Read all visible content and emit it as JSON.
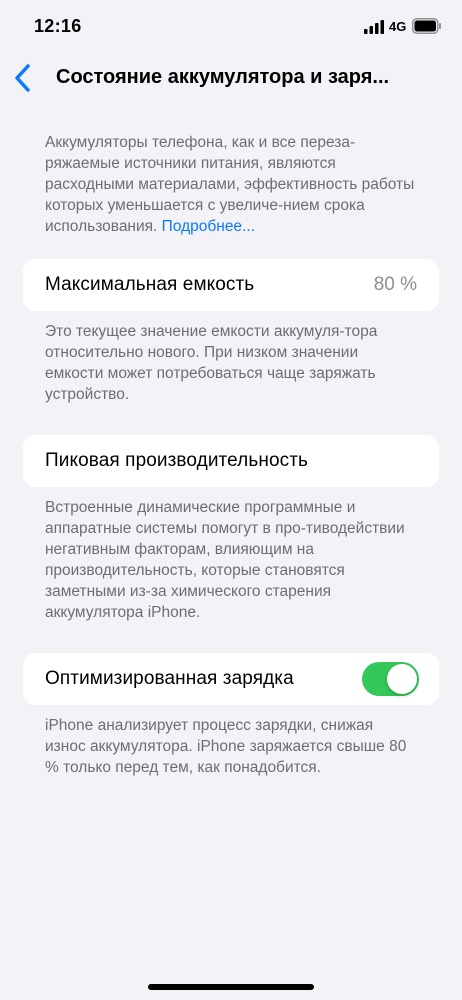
{
  "status_bar": {
    "time": "12:16",
    "network": "4G",
    "icons": [
      "signal-icon",
      "battery-icon"
    ]
  },
  "nav": {
    "title": "Состояние аккумулятора и заря...",
    "back_icon": "chevron-left-icon"
  },
  "intro": {
    "text": "Аккумуляторы телефона, как и все переза-ряжаемые источники питания, являются расходными материалами, эффективность работы которых уменьшается с увеличе-нием срока использования. ",
    "link": "Подробнее..."
  },
  "max_capacity": {
    "label": "Максимальная емкость",
    "value": "80 %",
    "footer": "Это текущее значение емкости аккумуля-тора относительно нового. При низком значении емкости может потребоваться чаще заряжать устройство."
  },
  "peak_performance": {
    "label": "Пиковая производительность",
    "footer": "Встроенные динамические программные и аппаратные системы помогут в про-тиводействии негативным факторам, влияющим на производительность, которые становятся заметными из-за химического старения аккумулятора iPhone."
  },
  "optimized_charging": {
    "label": "Оптимизированная зарядка",
    "enabled": true,
    "footer": "iPhone анализирует процесс зарядки, снижая износ аккумулятора. iPhone заряжается свыше 80 % только перед тем, как понадобится."
  },
  "colors": {
    "background": "#f2f2f7",
    "accent": "#0a7aff",
    "toggle_on": "#34c759",
    "secondary_text": "#6d6d72"
  }
}
